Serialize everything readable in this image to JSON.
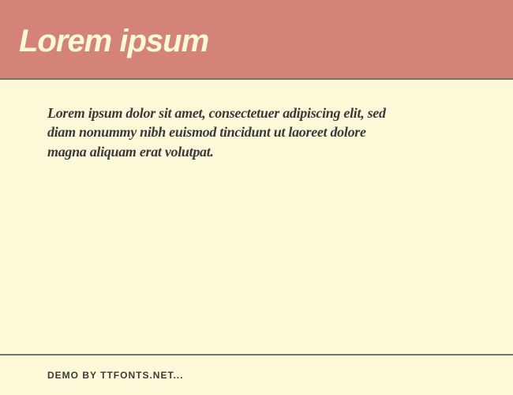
{
  "header": {
    "title": "Lorem ipsum"
  },
  "content": {
    "body_text": "Lorem ipsum dolor sit amet, consectetuer adipiscing elit, sed diam nonummy nibh euismod tincidunt ut laoreet dolore magna aliquam erat volutpat."
  },
  "footer": {
    "attribution": "DEMO BY TTFONTS.NET..."
  }
}
